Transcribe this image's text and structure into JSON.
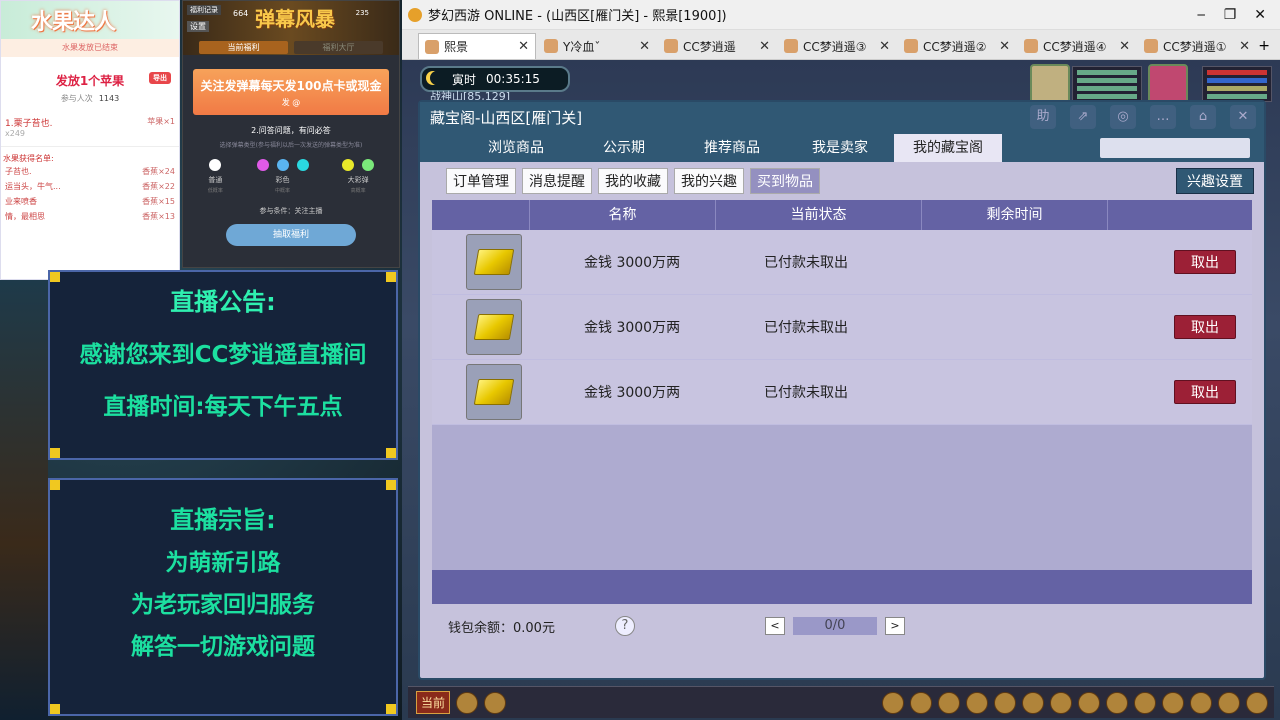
{
  "fruit": {
    "title": "水果达人",
    "status": "水果发放已结束",
    "prize": "发放1个苹果",
    "badge": "导出",
    "participants_label": "参与人次",
    "participants": "1143",
    "winner": "1.栗子苔也.",
    "winner_reward": "苹果×1",
    "winner_sub": "x249",
    "list_title": "水果获得名单:",
    "list": [
      {
        "name": "子苔也.",
        "reward": "香蕉×24"
      },
      {
        "name": "运当头，牛气...",
        "reward": "香蕉×22"
      },
      {
        "name": "业来喷香",
        "reward": "香蕉×15"
      },
      {
        "name": "情，最相思",
        "reward": "香蕉×13"
      }
    ]
  },
  "event": {
    "tab_record": "福利记录",
    "tab_settings": "设置",
    "num_left": "664",
    "title": "弹幕风暴",
    "num_right": "235",
    "tab_current": "当前福利",
    "tab_history": "福利大厅",
    "banner": "关注发弹幕每天发100点卡或现金",
    "banner_sub": "发 @",
    "question": "2.问答问题，有问必答",
    "hint": "选择弹幕类型(参与福利以后一次发送的弹幕类型为准)",
    "types": [
      {
        "label": "普通",
        "sub": "低概率",
        "colors": [
          "#ffffff"
        ]
      },
      {
        "label": "彩色",
        "sub": "中概率",
        "colors": [
          "#e05ae8",
          "#5ab4f0",
          "#2ad8e0"
        ]
      },
      {
        "label": "大彩弹",
        "sub": "高概率",
        "colors": [
          "#e8e82a",
          "#7ae87a"
        ]
      }
    ],
    "condition": "参与条件：关注主播",
    "button": "抽取福利"
  },
  "announcement": {
    "heading": "直播公告:",
    "line1": "感谢您来到CC梦逍遥直播间",
    "line2": "直播时间:每天下午五点"
  },
  "motto": {
    "heading": "直播宗旨:",
    "lines": [
      "为萌新引路",
      "为老玩家回归服务",
      "解答一切游戏问题"
    ]
  },
  "window": {
    "title": "梦幻西游 ONLINE - (山西区[雁门关] - 熙景[1900])",
    "min": "‒",
    "max": "❐",
    "close": "✕"
  },
  "tabs": [
    {
      "name": "熙景",
      "active": true
    },
    {
      "name": "Y冷血ˇ",
      "active": false
    },
    {
      "name": "CC梦逍遥",
      "active": false
    },
    {
      "name": "CC梦逍遥③",
      "active": false
    },
    {
      "name": "CC梦逍遥②",
      "active": false
    },
    {
      "name": "CC梦逍遥④",
      "active": false
    },
    {
      "name": "CC梦逍遥①",
      "active": false
    }
  ],
  "tab_close": "✕",
  "tab_add": "+",
  "game": {
    "time_label": "寅时",
    "time": "00:35:15",
    "location": "战神山[85,129]",
    "hud_current": "当前"
  },
  "shop": {
    "title": "藏宝阁-山西区[雁门关]",
    "tools": [
      "助",
      "⇗",
      "◎",
      "…",
      "⌂",
      "✕"
    ],
    "nav": [
      {
        "label": "浏览商品",
        "active": false
      },
      {
        "label": "公示期",
        "active": false
      },
      {
        "label": "推荐商品",
        "active": false
      },
      {
        "label": "我是卖家",
        "active": false
      },
      {
        "label": "我的藏宝阁",
        "active": true
      }
    ],
    "subnav": [
      {
        "label": "订单管理",
        "active": false
      },
      {
        "label": "消息提醒",
        "active": false
      },
      {
        "label": "我的收藏",
        "active": false
      },
      {
        "label": "我的兴趣",
        "active": false
      },
      {
        "label": "买到物品",
        "active": true
      }
    ],
    "interest_btn": "兴趣设置",
    "columns": [
      "",
      "名称",
      "当前状态",
      "剩余时间",
      ""
    ],
    "rows": [
      {
        "name": "金钱  3000万两",
        "status": "已付款未取出",
        "action": "取出"
      },
      {
        "name": "金钱  3000万两",
        "status": "已付款未取出",
        "action": "取出"
      },
      {
        "name": "金钱  3000万两",
        "status": "已付款未取出",
        "action": "取出"
      }
    ],
    "wallet": "钱包余额：0.00元",
    "help": "?",
    "prev": "<",
    "page": "0/0",
    "next": ">"
  },
  "colors": {
    "accent": "#305874",
    "take_btn": "#9c2036",
    "header": "#6462a4"
  }
}
